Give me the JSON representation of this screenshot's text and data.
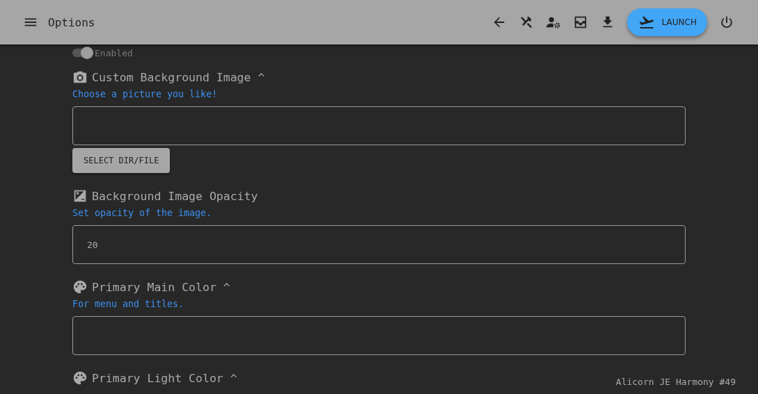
{
  "app_bar": {
    "title": "Options",
    "launch_label": "LAUNCH"
  },
  "settings": [
    {
      "kind": "toggle",
      "label": "Enabled",
      "on": true
    },
    {
      "kind": "field",
      "title": "Custom Background Image ^",
      "hint": "Choose a picture you like!",
      "button": "SELECT DIR/FILE"
    },
    {
      "kind": "field",
      "title": "Background Image Opacity",
      "hint": "Set opacity of the image.",
      "value": "20"
    },
    {
      "kind": "field",
      "title": "Primary Main Color ^",
      "hint": "For menu and titles."
    },
    {
      "kind": "heading",
      "title": "Primary Light Color ^"
    }
  ],
  "version": "Alicorn JE Harmony #49"
}
